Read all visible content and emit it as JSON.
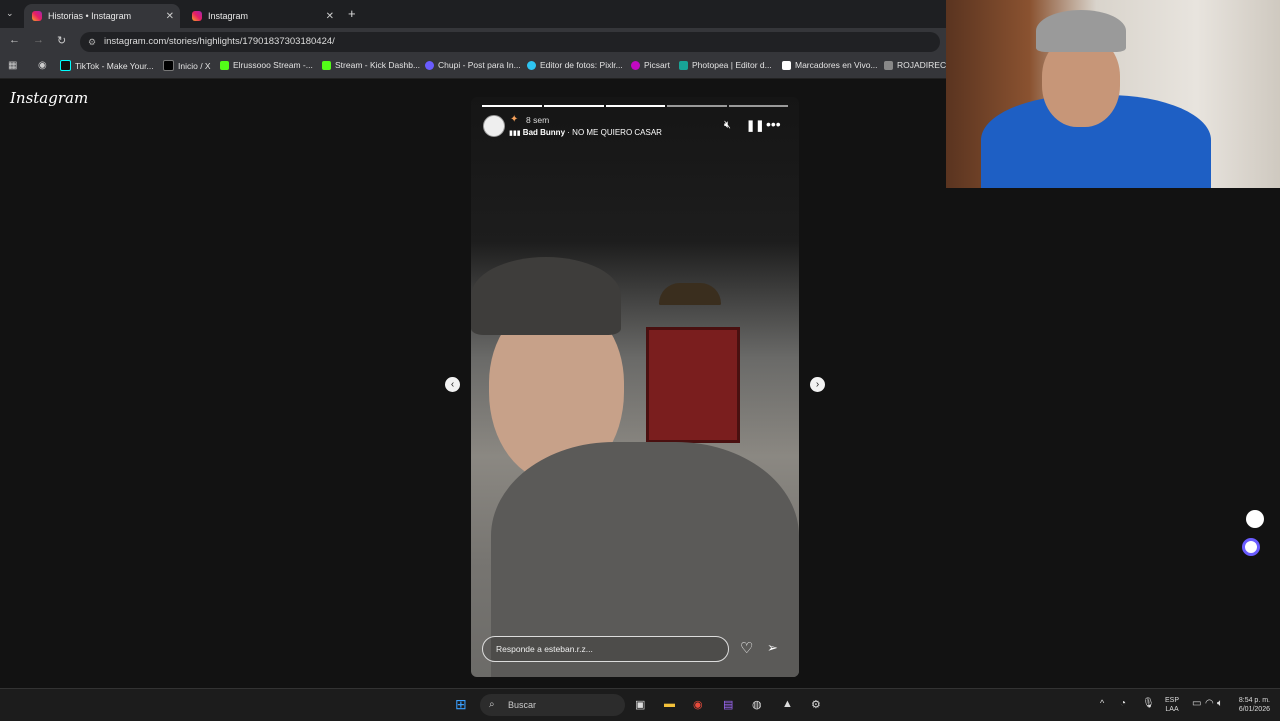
{
  "browser": {
    "tabs": [
      {
        "label": "Historias • Instagram",
        "active": true
      },
      {
        "label": "Instagram",
        "active": false
      }
    ],
    "url": "instagram.com/stories/highlights/17901837303180424/",
    "bookmarks": [
      "TikTok - Make Your...",
      "Inicio / X",
      "Elrussooo Stream -...",
      "Stream - Kick Dashb...",
      "Chupi - Post para In...",
      "Editor de fotos: Pixlr...",
      "Picsart",
      "Photopea | Editor d...",
      "Marcadores en Vivo...",
      "ROJADIRECTA"
    ]
  },
  "page": {
    "logo": "Instagram",
    "story": {
      "time": "8 sem",
      "music_artist": "Bad Bunny",
      "music_title": "NO ME QUIERO CASAR",
      "reply_placeholder": "Responde a esteban.r.z..."
    }
  },
  "taskbar": {
    "search_placeholder": "Buscar",
    "lang": "ESP",
    "lang2": "LAA",
    "time": "8:54 p. m.",
    "date": "6/01/2026"
  },
  "colors": {
    "background": "#121212",
    "accent": "#e91e63"
  }
}
